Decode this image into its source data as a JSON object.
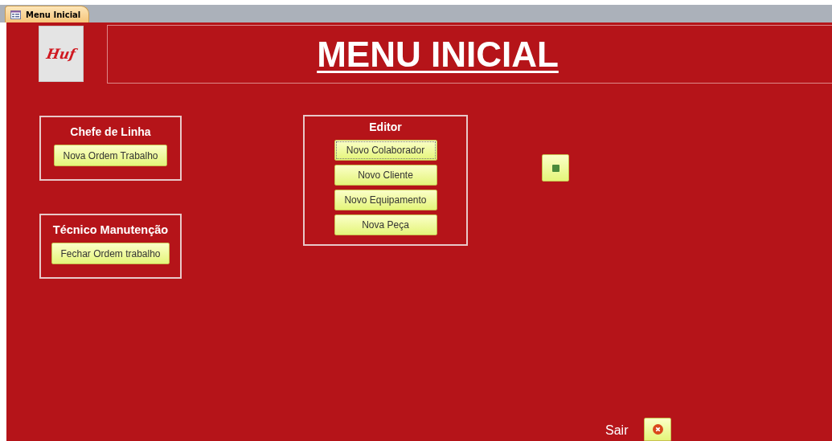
{
  "tab": {
    "label": "Menu Inicial",
    "selected": true
  },
  "logo_text": "Huf",
  "title": "MENU INICIAL",
  "sections": [
    {
      "title": "Chefe de Linha",
      "buttons": [
        {
          "label": "Nova Ordem Trabalho",
          "focused": false
        }
      ]
    },
    {
      "title": "Técnico Manutenção",
      "buttons": [
        {
          "label": "Fechar Ordem trabalho",
          "focused": false
        }
      ]
    },
    {
      "title": "Editor",
      "buttons": [
        {
          "label": "Novo Colaborador",
          "focused": true
        },
        {
          "label": "Novo Cliente",
          "focused": false
        },
        {
          "label": "Novo Equipamento",
          "focused": false
        },
        {
          "label": "Nova Peça",
          "focused": false
        }
      ]
    }
  ],
  "exit": {
    "label": "Sair"
  }
}
